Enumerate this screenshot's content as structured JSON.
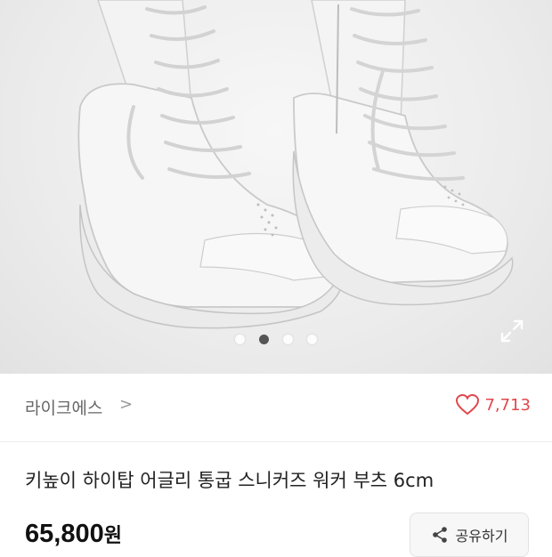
{
  "product": {
    "seller": "라이크에스",
    "seller_chevron": ">",
    "likes": "7,713",
    "title": "키높이 하이탑 어글리 통굽 스니커즈 워커 부츠 6cm",
    "price": "65,800",
    "currency": "원"
  },
  "gallery": {
    "total": 4,
    "active_index": 1
  },
  "actions": {
    "share_label": "공유하기"
  },
  "colors": {
    "like": "#e0474c",
    "active_dot": "#555555"
  },
  "icons": {
    "heart": "heart-icon",
    "share": "share-icon",
    "expand": "expand-icon",
    "chevron": "chevron-right-icon"
  }
}
